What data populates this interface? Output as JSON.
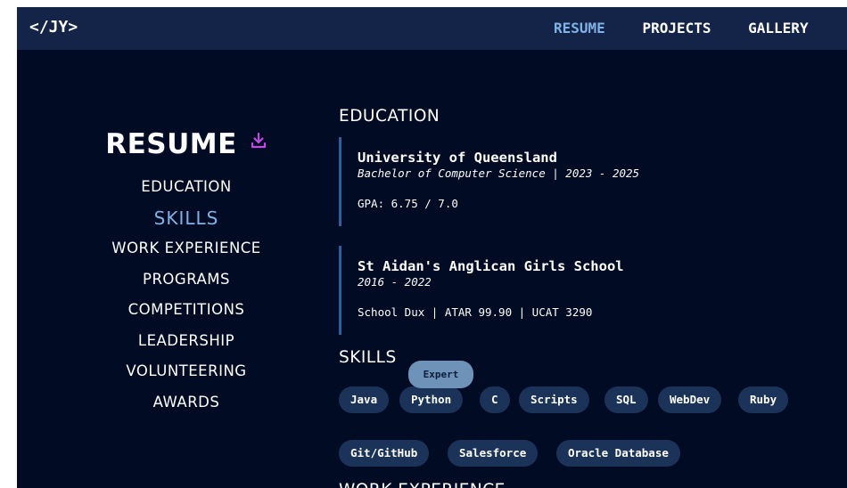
{
  "navbar": {
    "logo": "</JY>",
    "links": [
      "RESUME",
      "PROJECTS",
      "GALLERY"
    ],
    "active_link": "RESUME"
  },
  "sidebar": {
    "title": "RESUME",
    "download_icon": "download-icon",
    "items": [
      "EDUCATION",
      "SKILLS",
      "WORK EXPERIENCE",
      "PROGRAMS",
      "COMPETITIONS",
      "LEADERSHIP",
      "VOLUNTEERING",
      "AWARDS"
    ],
    "active_item": "SKILLS"
  },
  "education": {
    "heading": "EDUCATION",
    "entries": [
      {
        "school": "University of Queensland",
        "subtitle": "Bachelor of Computer Science | 2023 - 2025",
        "detail": "GPA: 6.75 / 7.0"
      },
      {
        "school": "St Aidan's Anglican Girls School",
        "subtitle": "2016 - 2022",
        "detail": "School Dux | ATAR 99.90 | UCAT 3290"
      }
    ]
  },
  "skills": {
    "heading": "SKILLS",
    "tooltip": "Expert",
    "pills": [
      "Java",
      "Python",
      "C",
      "Scripts",
      "SQL",
      "WebDev",
      "Ruby",
      "Git/GitHub",
      "Salesforce",
      "Oracle Database"
    ]
  },
  "next_section": {
    "heading": "WORK EXPERIENCE"
  },
  "colors": {
    "page_bg": "#020b24",
    "navbar_bg": "#142448",
    "accent": "#7fb2e5",
    "pill_bg": "#1b3358",
    "tooltip_bg": "#6f92b8",
    "download_icon": "#c04be0"
  }
}
